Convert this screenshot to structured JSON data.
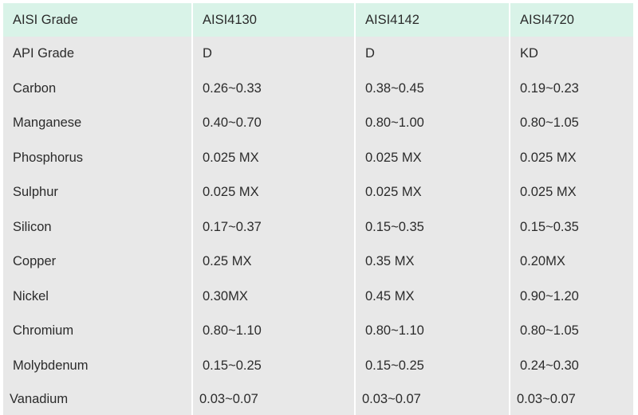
{
  "table": {
    "headers": [
      "AISI Grade",
      "AISI4130",
      "AISI4142",
      "AISI4720"
    ],
    "rows": [
      [
        "API Grade",
        "D",
        "D",
        "KD"
      ],
      [
        "Carbon",
        "0.26~0.33",
        "0.38~0.45",
        "0.19~0.23"
      ],
      [
        "Manganese",
        "0.40~0.70",
        "0.80~1.00",
        "0.80~1.05"
      ],
      [
        "Phosphorus",
        "0.025 MX",
        "0.025 MX",
        "0.025 MX"
      ],
      [
        "Sulphur",
        "0.025 MX",
        "0.025 MX",
        "0.025 MX"
      ],
      [
        "Silicon",
        "0.17~0.37",
        "0.15~0.35",
        "0.15~0.35"
      ],
      [
        "Copper",
        "0.25 MX",
        "0.35 MX",
        "0.20MX"
      ],
      [
        "Nickel",
        "0.30MX",
        "0.45 MX",
        "0.90~1.20"
      ],
      [
        "Chromium",
        "0.80~1.10",
        "0.80~1.10",
        "0.80~1.05"
      ],
      [
        "Molybdenum",
        "0.15~0.25",
        "0.15~0.25",
        "0.24~0.30"
      ],
      [
        "Vanadium",
        "0.03~0.07",
        "0.03~0.07",
        "0.03~0.07"
      ]
    ],
    "header_bg": "#d9f3e8",
    "cell_bg": "#e8e8e8"
  }
}
